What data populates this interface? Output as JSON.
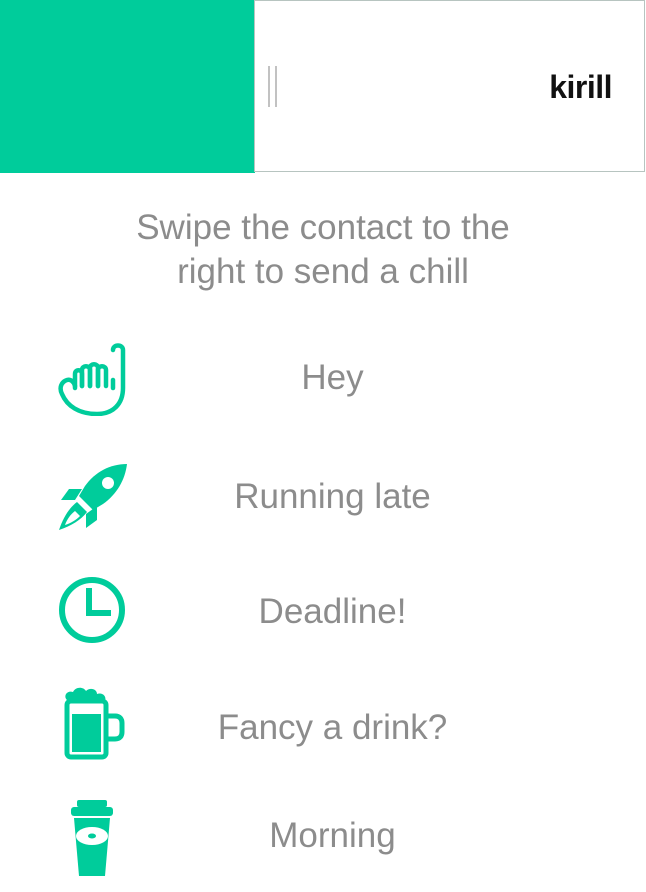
{
  "contact": {
    "name": "kirill"
  },
  "instructions": {
    "line1": "Swipe the contact to the",
    "line2": "right to send a chill"
  },
  "chills": [
    {
      "label": "Hey",
      "icon": "hang-loose-hand-icon"
    },
    {
      "label": "Running late",
      "icon": "rocket-icon"
    },
    {
      "label": "Deadline!",
      "icon": "clock-icon"
    },
    {
      "label": "Fancy a drink?",
      "icon": "beer-mug-icon"
    },
    {
      "label": "Morning",
      "icon": "coffee-cup-icon"
    }
  ],
  "colors": {
    "accent": "#00cc9b",
    "label_text": "#8c8c8c",
    "name_text": "#111111"
  }
}
